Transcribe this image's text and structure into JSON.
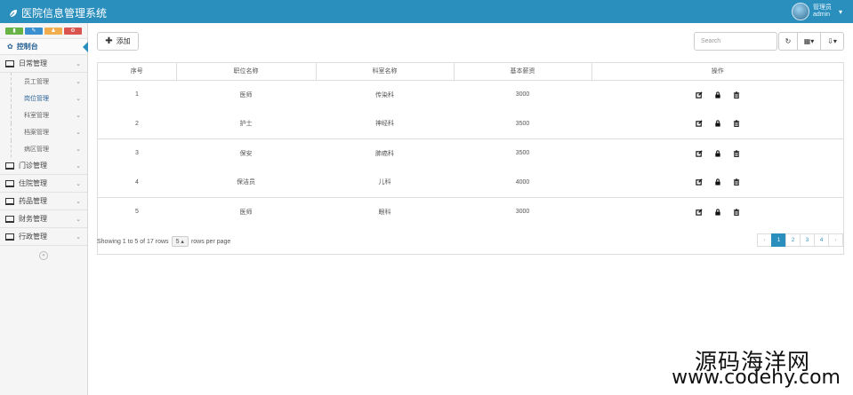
{
  "header": {
    "title": "医院信息管理系统",
    "user_name": "管理员",
    "user_role": "admin"
  },
  "colors": {
    "accent": "#2a8fbd",
    "shortcut_colors": [
      "#67b346",
      "#3a8fd0",
      "#f0ad4e",
      "#d9534f"
    ]
  },
  "sidebar": {
    "shortcut_icons": [
      "signal-icon",
      "pencil-icon",
      "users-icon",
      "cogs-icon"
    ],
    "dashboard_label": "控制台",
    "menu": [
      {
        "label": "日常管理",
        "children": [
          "员工管理",
          "岗位管理",
          "科室管理",
          "档案管理",
          "病区管理"
        ]
      },
      {
        "label": "门诊管理"
      },
      {
        "label": "住院管理"
      },
      {
        "label": "药品管理"
      },
      {
        "label": "财务管理"
      },
      {
        "label": "行政管理"
      }
    ]
  },
  "toolbar": {
    "add_label": "添加",
    "search_placeholder": "Search"
  },
  "table": {
    "columns": [
      "序号",
      "职位名称",
      "科室名称",
      "基本薪资",
      "操作"
    ],
    "rows": [
      [
        "1",
        "医师",
        "传染科",
        "3000"
      ],
      [
        "2",
        "护士",
        "神经科",
        "3500"
      ],
      [
        "3",
        "保安",
        "肺癌科",
        "3500"
      ],
      [
        "4",
        "保洁员",
        "儿科",
        "4000"
      ],
      [
        "5",
        "医师",
        "眼科",
        "3000"
      ]
    ]
  },
  "pagination": {
    "showing_text": "Showing 1 to 5 of 17 rows",
    "page_size": "5",
    "per_page_text": "rows per page",
    "prev": "‹",
    "next": "›",
    "pages": [
      "1",
      "2",
      "3",
      "4"
    ],
    "current_page": "1"
  },
  "watermark": {
    "line1": "源码海洋网",
    "line2": "www.codehy.com"
  }
}
